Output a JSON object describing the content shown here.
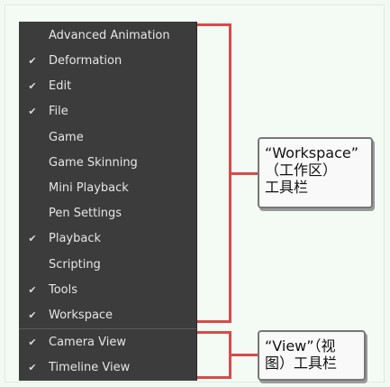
{
  "menu": {
    "items": [
      {
        "label": "Advanced Animation",
        "checked": false
      },
      {
        "label": "Deformation",
        "checked": true
      },
      {
        "label": "Edit",
        "checked": true
      },
      {
        "label": "File",
        "checked": true
      },
      {
        "label": "Game",
        "checked": false
      },
      {
        "label": "Game Skinning",
        "checked": false
      },
      {
        "label": "Mini Playback",
        "checked": false
      },
      {
        "label": "Pen Settings",
        "checked": false
      },
      {
        "label": "Playback",
        "checked": true
      },
      {
        "label": "Scripting",
        "checked": false
      },
      {
        "label": "Tools",
        "checked": true
      },
      {
        "label": "Workspace",
        "checked": true
      },
      {
        "label": "Camera View",
        "checked": true
      },
      {
        "label": "Timeline View",
        "checked": true
      }
    ],
    "check_glyph": "✔"
  },
  "callouts": {
    "workspace": "“Workspace”\n（工作区）\n工具栏",
    "view": "“View”（视\n图）工具栏"
  },
  "colors": {
    "menu_bg": "#3c3c3c",
    "highlight": "#d94a4a"
  }
}
